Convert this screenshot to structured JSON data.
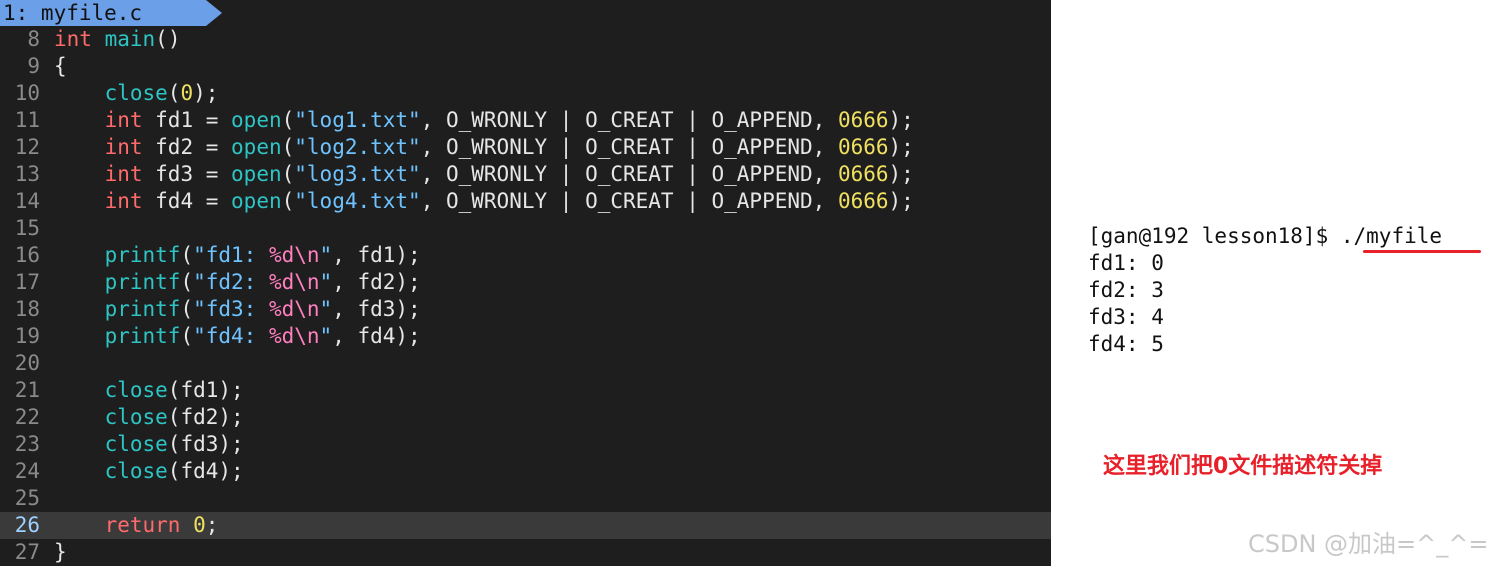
{
  "editor": {
    "tab_label": "1: myfile.c",
    "lines": {
      "l8": {
        "no": "8",
        "t1": "int",
        "t2": " ",
        "t3": "main",
        "t4": "()"
      },
      "l9": {
        "no": "9",
        "t1": "{"
      },
      "l10": {
        "no": "10",
        "t1": "    ",
        "t2": "close",
        "t3": "(",
        "t4": "0",
        "t5": ");"
      },
      "l11": {
        "no": "11",
        "t1": "    ",
        "t2": "int",
        "t3": " fd1 = ",
        "t4": "open",
        "t5": "(",
        "t6": "\"log1.txt\"",
        "t7": ", O_WRONLY | O_CREAT | O_APPEND, ",
        "t8": "0666",
        "t9": ");"
      },
      "l12": {
        "no": "12",
        "t1": "    ",
        "t2": "int",
        "t3": " fd2 = ",
        "t4": "open",
        "t5": "(",
        "t6": "\"log2.txt\"",
        "t7": ", O_WRONLY | O_CREAT | O_APPEND, ",
        "t8": "0666",
        "t9": ");"
      },
      "l13": {
        "no": "13",
        "t1": "    ",
        "t2": "int",
        "t3": " fd3 = ",
        "t4": "open",
        "t5": "(",
        "t6": "\"log3.txt\"",
        "t7": ", O_WRONLY | O_CREAT | O_APPEND, ",
        "t8": "0666",
        "t9": ");"
      },
      "l14": {
        "no": "14",
        "t1": "    ",
        "t2": "int",
        "t3": " fd4 = ",
        "t4": "open",
        "t5": "(",
        "t6": "\"log4.txt\"",
        "t7": ", O_WRONLY | O_CREAT | O_APPEND, ",
        "t8": "0666",
        "t9": ");"
      },
      "l15": {
        "no": "15"
      },
      "l16": {
        "no": "16",
        "t1": "    ",
        "t2": "printf",
        "t3": "(",
        "t4": "\"fd1: ",
        "t5": "%d\\n",
        "t6": "\"",
        "t7": ", fd1);"
      },
      "l17": {
        "no": "17",
        "t1": "    ",
        "t2": "printf",
        "t3": "(",
        "t4": "\"fd2: ",
        "t5": "%d\\n",
        "t6": "\"",
        "t7": ", fd2);"
      },
      "l18": {
        "no": "18",
        "t1": "    ",
        "t2": "printf",
        "t3": "(",
        "t4": "\"fd3: ",
        "t5": "%d\\n",
        "t6": "\"",
        "t7": ", fd3);"
      },
      "l19": {
        "no": "19",
        "t1": "    ",
        "t2": "printf",
        "t3": "(",
        "t4": "\"fd4: ",
        "t5": "%d\\n",
        "t6": "\"",
        "t7": ", fd4);"
      },
      "l20": {
        "no": "20"
      },
      "l21": {
        "no": "21",
        "t1": "    ",
        "t2": "close",
        "t3": "(fd1);"
      },
      "l22": {
        "no": "22",
        "t1": "    ",
        "t2": "close",
        "t3": "(fd2);"
      },
      "l23": {
        "no": "23",
        "t1": "    ",
        "t2": "close",
        "t3": "(fd3);"
      },
      "l24": {
        "no": "24",
        "t1": "    ",
        "t2": "close",
        "t3": "(fd4);"
      },
      "l25": {
        "no": "25"
      },
      "l26": {
        "no": "26",
        "t1": "    ",
        "t2": "return",
        "t3": " ",
        "t4": "0",
        "t5": ";"
      },
      "l27": {
        "no": "27",
        "t1": "}"
      }
    }
  },
  "terminal": {
    "prompt": "[gan@192 lesson18]$ ",
    "command": "./myfile",
    "output": [
      "fd1: 0",
      "fd2: 3",
      "fd3: 4",
      "fd4: 5"
    ]
  },
  "annotation": "这里我们把0文件描述符关掉",
  "watermark": "CSDN @加油=^_^=",
  "colors": {
    "editor_bg": "#1e1e1e",
    "tab": "#6b9fe8",
    "keyword": "#ff6b6b",
    "function": "#2ec4c4",
    "string": "#6ec3ff",
    "format": "#ff7fc0",
    "number": "#f0e060",
    "annotation": "#e8202a"
  }
}
